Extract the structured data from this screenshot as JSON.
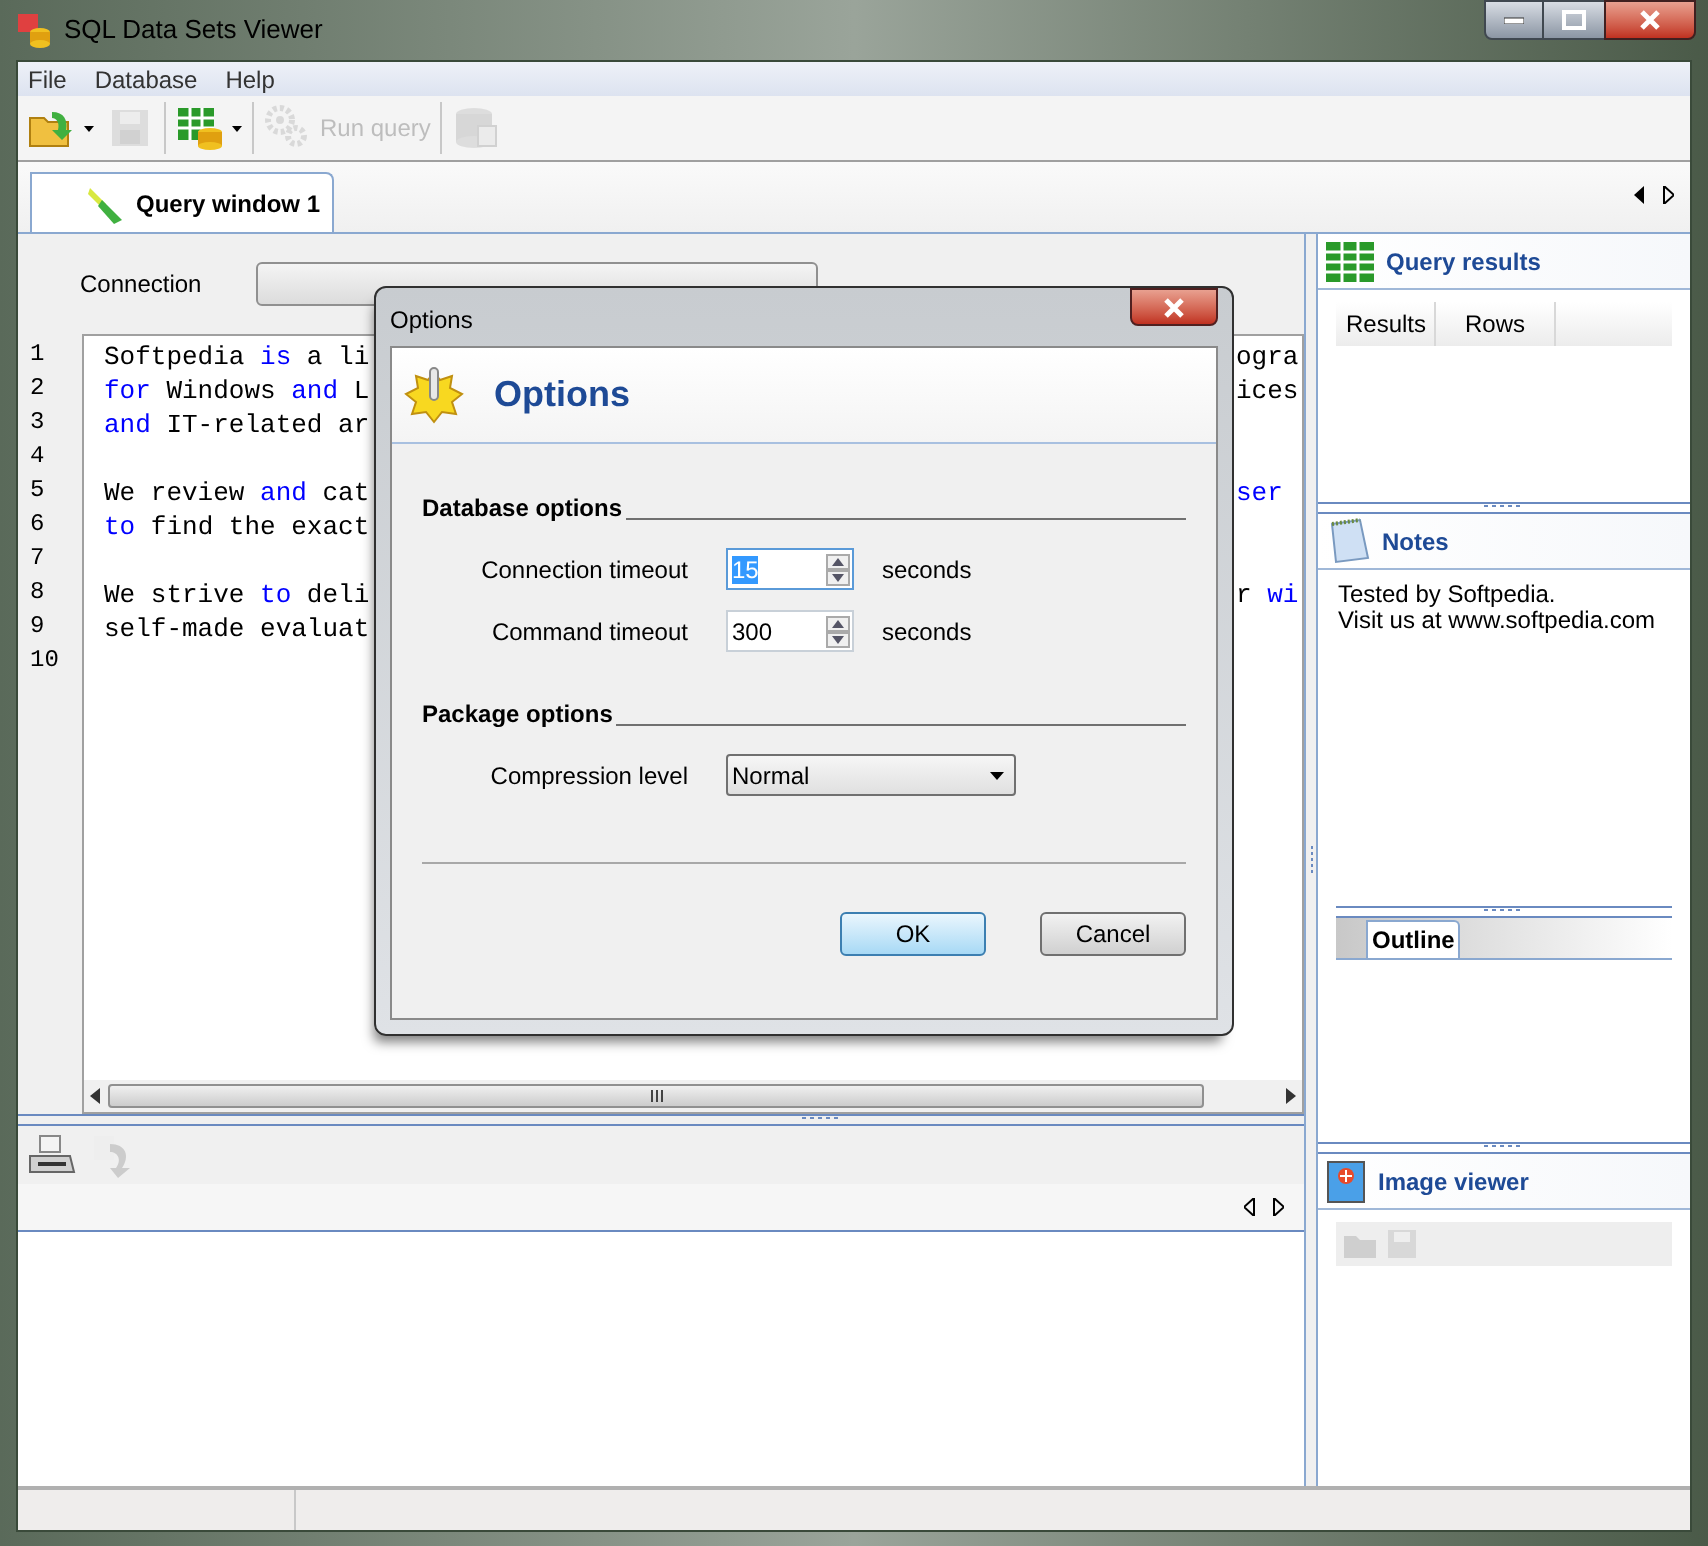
{
  "window": {
    "title": "SQL Data Sets Viewer"
  },
  "menu": [
    "File",
    "Database",
    "Help"
  ],
  "toolbar": [
    {
      "kind": "open",
      "disabled": false,
      "dropdown": true
    },
    {
      "kind": "save",
      "disabled": true,
      "dropdown": false
    },
    {
      "kind": "table",
      "disabled": false,
      "dropdown": true
    },
    {
      "kind": "run",
      "disabled": true,
      "dropdown": false,
      "label": "Run query"
    },
    {
      "kind": "database",
      "disabled": true,
      "dropdown": false
    }
  ],
  "tabs": [
    {
      "label": "Query window 1",
      "selected": true
    }
  ],
  "connection": {
    "label": "Connection"
  },
  "editor": {
    "lines": [
      {
        "number": "1",
        "left": [
          {
            "text": "Softpedia ",
            "keyword": false
          },
          {
            "text": "is",
            "keyword": true
          },
          {
            "text": " a li",
            "keyword": false
          }
        ],
        "right": [
          {
            "text": "ogra",
            "keyword": false
          }
        ]
      },
      {
        "number": "2",
        "left": [
          {
            "text": "for",
            "keyword": true
          },
          {
            "text": " Windows ",
            "keyword": false
          },
          {
            "text": "and",
            "keyword": true
          },
          {
            "text": " L",
            "keyword": false
          }
        ],
        "right": [
          {
            "text": "ices",
            "keyword": false
          }
        ]
      },
      {
        "number": "3",
        "left": [
          {
            "text": "and",
            "keyword": true
          },
          {
            "text": " IT-related ar",
            "keyword": false
          }
        ]
      },
      {
        "number": "4"
      },
      {
        "number": "5",
        "left": [
          {
            "text": "We review ",
            "keyword": false
          },
          {
            "text": "and",
            "keyword": true
          },
          {
            "text": " cat",
            "keyword": false
          }
        ],
        "right": [
          {
            "text": "ser",
            "keyword": true
          }
        ]
      },
      {
        "number": "6",
        "left": [
          {
            "text": "to",
            "keyword": true
          },
          {
            "text": " find the exact",
            "keyword": false
          }
        ]
      },
      {
        "number": "7"
      },
      {
        "number": "8",
        "left": [
          {
            "text": "We strive ",
            "keyword": false
          },
          {
            "text": "to",
            "keyword": true
          },
          {
            "text": " deli",
            "keyword": false
          }
        ],
        "right": [
          {
            "text": "r ",
            "keyword": false
          },
          {
            "text": "wi",
            "keyword": true
          }
        ]
      },
      {
        "number": "9",
        "left": [
          {
            "text": "self-made evaluat",
            "keyword": false
          }
        ]
      },
      {
        "number": "10"
      }
    ]
  },
  "results": {
    "title": "Query results",
    "columns": [
      "Results",
      "Rows"
    ]
  },
  "notes": {
    "title": "Notes",
    "lines": [
      "Tested by Softpedia.",
      "Visit us at www.softpedia.com"
    ]
  },
  "outline": {
    "tabs": [
      {
        "label": "Outline",
        "selected": true
      }
    ]
  },
  "image_viewer": {
    "title": "Image viewer"
  },
  "dialog": {
    "title": "Options",
    "heading": "Options",
    "sections": [
      {
        "title": "Database options",
        "fields": [
          {
            "kind": "spin",
            "label": "Connection timeout",
            "value": "15",
            "unit": "seconds",
            "focused": true
          },
          {
            "kind": "spin",
            "label": "Command timeout",
            "value": "300",
            "unit": "seconds",
            "focused": false
          }
        ]
      },
      {
        "title": "Package options",
        "fields": [
          {
            "kind": "select",
            "label": "Compression level",
            "value": "Normal",
            "focused": false
          }
        ]
      }
    ],
    "buttons": [
      {
        "label": "OK",
        "default": true
      },
      {
        "label": "Cancel",
        "default": false
      }
    ]
  }
}
